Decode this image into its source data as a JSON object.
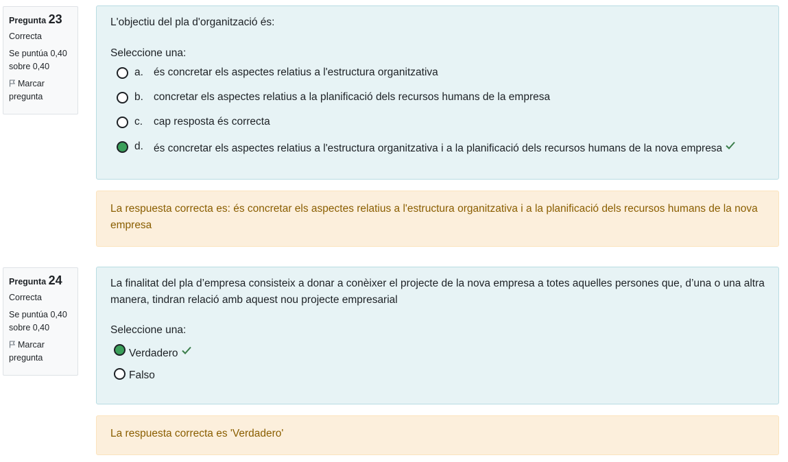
{
  "questions": [
    {
      "label": "Pregunta",
      "number": "23",
      "state": "Correcta",
      "grade_line1": "Se puntúa 0,40",
      "grade_line2": "sobre 0,40",
      "flag_line1": "Marcar",
      "flag_line2": "pregunta",
      "text": "L'objectiu del pla d'organització és:",
      "prompt": "Seleccione una:",
      "answers": [
        {
          "letter": "a.",
          "text": "és concretar els aspectes relatius a l'estructura organitzativa",
          "selected": false
        },
        {
          "letter": "b.",
          "text": "concretar els aspectes relatius a la planificació dels recursos humans de la empresa",
          "selected": false
        },
        {
          "letter": "c.",
          "text": "cap resposta és correcta",
          "selected": false
        },
        {
          "letter": "d.",
          "text": "és concretar els aspectes relatius a l'estructura organitzativa i a la planificació dels recursos humans de la nova empresa",
          "selected": true,
          "correct_mark": true
        }
      ],
      "feedback": "La respuesta correcta es: és concretar els aspectes relatius a l'estructura organitzativa i a la planificació dels recursos humans de la nova empresa"
    },
    {
      "label": "Pregunta",
      "number": "24",
      "state": "Correcta",
      "grade_line1": "Se puntúa 0,40",
      "grade_line2": "sobre 0,40",
      "flag_line1": "Marcar",
      "flag_line2": "pregunta",
      "text": "La finalitat del pla d’empresa consisteix a donar a conèixer el projecte de la nova empresa a totes aquelles persones que, d’una o una altra manera, tindran relació amb aquest nou projecte empresarial",
      "prompt": "Seleccione una:",
      "answers": [
        {
          "text": "Verdadero",
          "selected": true,
          "correct_mark": true
        },
        {
          "text": "Falso",
          "selected": false
        }
      ],
      "feedback": "La respuesta correcta es 'Verdadero'"
    }
  ],
  "colors": {
    "selected_radio": "#3a9f5a",
    "check": "#3a7d4a",
    "formulation_bg": "#e7f3f5",
    "feedback_bg": "#fcefdc",
    "feedback_text": "#8a5e00"
  },
  "icons": {
    "flag": "flag-icon",
    "check": "check-icon"
  }
}
